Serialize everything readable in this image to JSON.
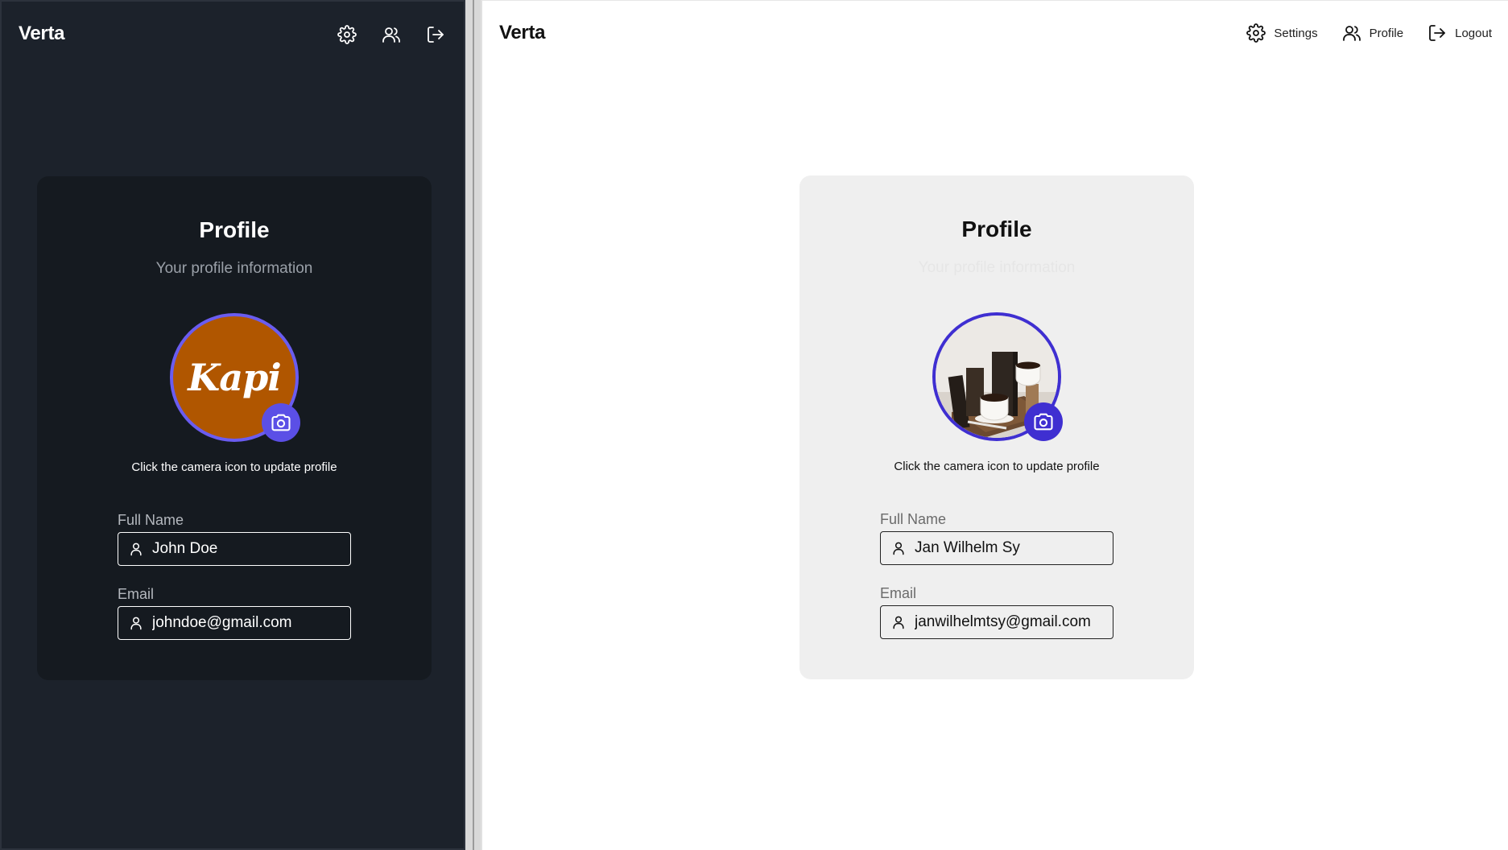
{
  "dark": {
    "brand": "Verta",
    "nav": [
      {
        "icon": "gear-icon"
      },
      {
        "icon": "users-icon"
      },
      {
        "icon": "logout-icon"
      }
    ],
    "card": {
      "title": "Profile",
      "subtitle": "Your profile information",
      "avatar_text": "Kapi",
      "avatar_color": "#b05600",
      "hint": "Click the camera icon to update profile",
      "full_name_label": "Full Name",
      "full_name_value": "John Doe",
      "email_label": "Email",
      "email_value": "johndoe@gmail.com"
    }
  },
  "light": {
    "brand": "Verta",
    "nav": [
      {
        "icon": "gear-icon",
        "label": "Settings"
      },
      {
        "icon": "users-icon",
        "label": "Profile"
      },
      {
        "icon": "logout-icon",
        "label": "Logout"
      }
    ],
    "card": {
      "title": "Profile",
      "subtitle": "Your profile information",
      "hint": "Click the camera icon to update profile",
      "full_name_label": "Full Name",
      "full_name_value": "Jan Wilhelm Sy",
      "email_label": "Email",
      "email_value": "janwilhelmtsy@gmail.com"
    }
  },
  "colors": {
    "accent": "#5b4fe6",
    "accent_light": "#3f2fd1",
    "dark_bg": "#1c222b",
    "dark_card": "#151a20"
  }
}
